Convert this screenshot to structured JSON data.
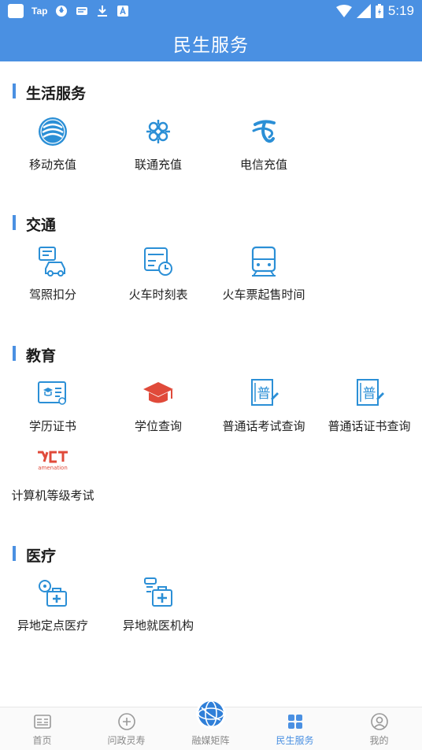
{
  "status_bar": {
    "time": "5:19",
    "left_text": "Tap",
    "icons": [
      "square-app-icon",
      "tap-app-icon",
      "aperture-icon",
      "message-icon",
      "download-icon",
      "a-box-icon",
      "wifi-icon",
      "signal-icon",
      "battery-icon"
    ]
  },
  "header": {
    "title": "民生服务"
  },
  "sections": [
    {
      "title": "生活服务",
      "items": [
        {
          "label": "移动充值",
          "icon": "china-mobile-icon"
        },
        {
          "label": "联通充值",
          "icon": "china-unicom-icon"
        },
        {
          "label": "电信充值",
          "icon": "china-telecom-icon"
        }
      ]
    },
    {
      "title": "交通",
      "items": [
        {
          "label": "驾照扣分",
          "icon": "driving-license-icon"
        },
        {
          "label": "火车时刻表",
          "icon": "train-timetable-icon"
        },
        {
          "label": "火车票起售时间",
          "icon": "train-ticket-icon"
        }
      ]
    },
    {
      "title": "教育",
      "items": [
        {
          "label": "学历证书",
          "icon": "diploma-icon"
        },
        {
          "label": "学位查询",
          "icon": "graduation-cap-icon"
        },
        {
          "label": "普通话考试查询",
          "icon": "mandarin-exam-icon"
        },
        {
          "label": "普通话证书查询",
          "icon": "mandarin-certificate-icon"
        },
        {
          "label": "计算机等级考试",
          "icon": "ncre-logo-icon",
          "logo_text": "amenation"
        }
      ]
    },
    {
      "title": "医疗",
      "items": [
        {
          "label": "异地定点医疗",
          "icon": "designated-medical-icon"
        },
        {
          "label": "异地就医机构",
          "icon": "medical-institution-icon"
        }
      ]
    }
  ],
  "bottom_nav": {
    "tabs": [
      {
        "label": "首页",
        "icon": "home-news-icon",
        "active": false
      },
      {
        "label": "问政灵寿",
        "icon": "plus-circle-icon",
        "active": false
      },
      {
        "label": "融媒矩阵",
        "icon": "globe-icon",
        "active": false
      },
      {
        "label": "民生服务",
        "icon": "grid-icon",
        "active": true
      },
      {
        "label": "我的",
        "icon": "user-icon",
        "active": false
      }
    ]
  },
  "colors": {
    "primary": "#4a90e2",
    "icon_teal": "#2b8fd6",
    "icon_red": "#e04a3a",
    "inactive_tab": "#888888"
  }
}
